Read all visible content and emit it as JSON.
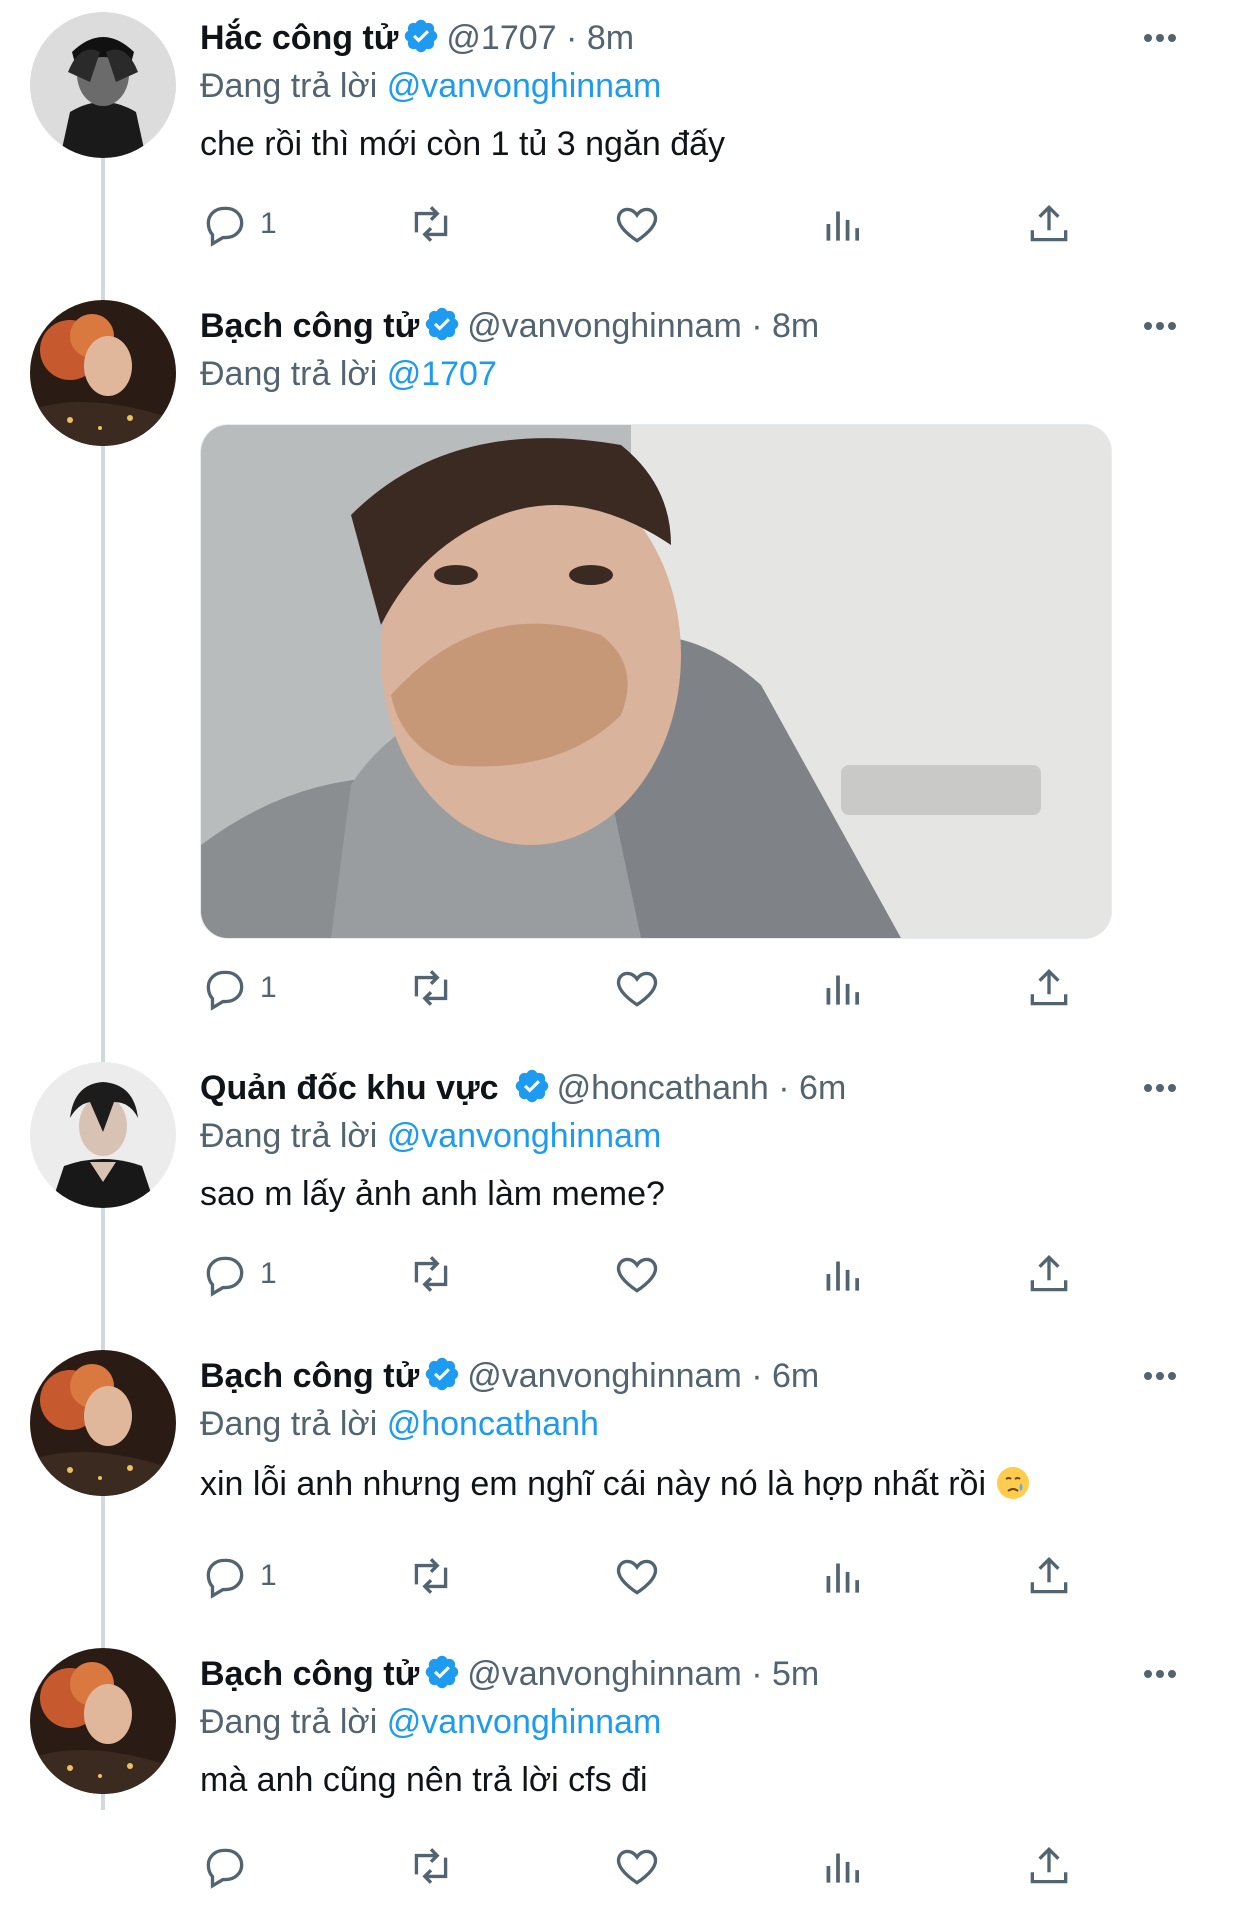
{
  "reply_prefix": "Đang trả lời",
  "tweets": [
    {
      "name": "Hắc công tử",
      "handle": "@1707",
      "sep": "·",
      "time": "8m",
      "reply_to": "@vanvonghinnam",
      "text": "che rồi thì mới còn 1 tủ 3 ngăn đấy",
      "reply_count": "1"
    },
    {
      "name": "Bạch công tử",
      "handle": "@vanvonghinnam",
      "sep": "·",
      "time": "8m",
      "reply_to": "@1707",
      "text": "",
      "reply_count": "1"
    },
    {
      "name": "Quản đốc khu vực",
      "handle": "@honcathanh",
      "sep": "·",
      "time": "6m",
      "reply_to": "@vanvonghinnam",
      "text": "sao m lấy ảnh anh làm meme?",
      "reply_count": "1"
    },
    {
      "name": "Bạch công tử",
      "handle": "@vanvonghinnam",
      "sep": "·",
      "time": "6m",
      "reply_to": "@honcathanh",
      "text": "xin lỗi anh nhưng em nghĩ cái này nó là hợp nhất rồi",
      "reply_count": "1"
    },
    {
      "name": "Bạch công tử",
      "handle": "@vanvonghinnam",
      "sep": "·",
      "time": "5m",
      "reply_to": "@vanvonghinnam",
      "text": "mà anh cũng nên trả lời cfs đi",
      "reply_count": ""
    }
  ],
  "icons": {
    "reply": "reply-icon",
    "retweet": "retweet-icon",
    "like": "like-icon",
    "views": "views-icon",
    "share": "share-icon",
    "more": "more-icon",
    "verified": "verified-badge-icon",
    "emoji": "crying-face-emoji"
  },
  "colors": {
    "accent": "#1d9bf0",
    "muted": "#536471",
    "text": "#0f1419",
    "line": "#cfd9de"
  }
}
